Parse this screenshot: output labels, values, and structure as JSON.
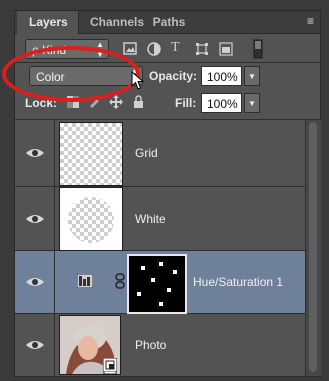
{
  "tabs": [
    {
      "label": "Layers"
    },
    {
      "label": "Channels"
    },
    {
      "label": "Paths"
    }
  ],
  "filter": {
    "kind_label": "ρ Kind"
  },
  "blend": {
    "mode": "Color",
    "opacity_label": "Opacity:",
    "opacity_value": "100%"
  },
  "lock": {
    "label": "Lock:",
    "fill_label": "Fill:",
    "fill_value": "100%"
  },
  "layers": [
    {
      "name": "Grid"
    },
    {
      "name": "White"
    },
    {
      "name": "Hue/Saturation 1"
    },
    {
      "name": "Photo"
    }
  ],
  "colors": {
    "selected_row": "#6f819a",
    "highlight_ring": "#e01d1d",
    "panel": "#535353"
  }
}
